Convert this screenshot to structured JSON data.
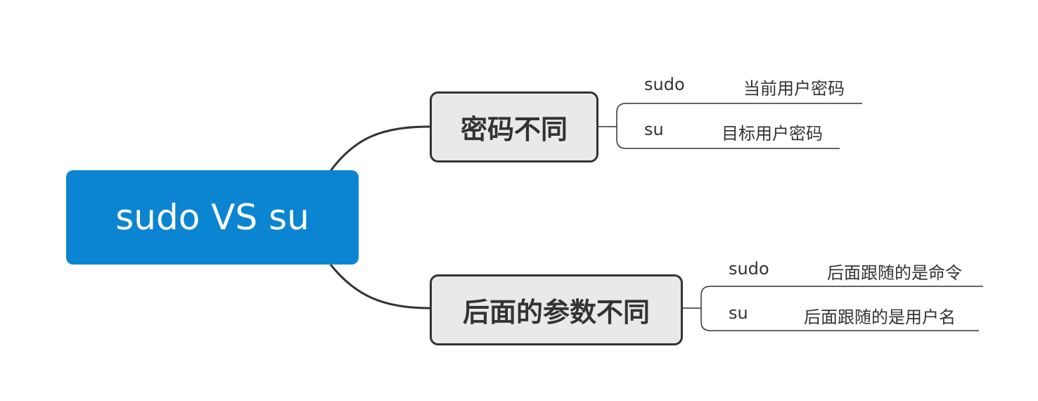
{
  "root": {
    "label": "sudo VS su"
  },
  "branches": [
    {
      "label": "密码不同",
      "leaves": [
        {
          "key": "sudo",
          "value": "当前用户密码"
        },
        {
          "key": "su",
          "value": "目标用户密码"
        }
      ]
    },
    {
      "label": "后面的参数不同",
      "leaves": [
        {
          "key": "sudo",
          "value": "后面跟随的是命令"
        },
        {
          "key": "su",
          "value": "后面跟随的是用户名"
        }
      ]
    }
  ],
  "colors": {
    "root_fill": "#0b84d2",
    "branch_fill": "#e9e9e9",
    "line": "#333333"
  }
}
